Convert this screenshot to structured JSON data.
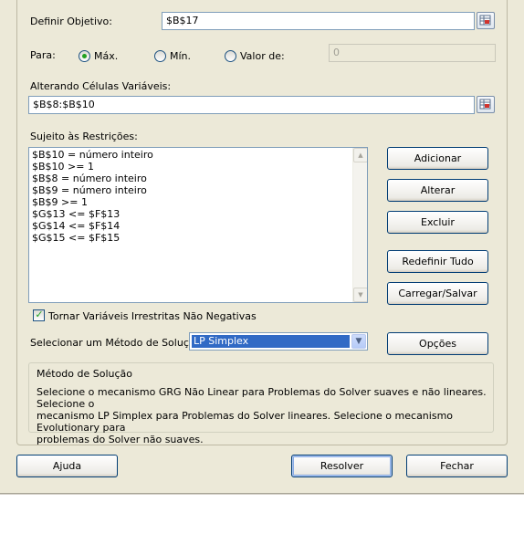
{
  "objective": {
    "label": "Definir Objetivo:",
    "value": "$B$17"
  },
  "para": {
    "label": "Para:",
    "options": [
      {
        "label": "Máx.",
        "selected": true
      },
      {
        "label": "Mín.",
        "selected": false
      },
      {
        "label": "Valor de:",
        "selected": false
      }
    ],
    "value_of": "0"
  },
  "variable_cells": {
    "label": "Alterando Células Variáveis:",
    "value": "$B$8:$B$10"
  },
  "constraints": {
    "label": "Sujeito às Restrições:",
    "items": [
      "$B$10 = número inteiro",
      "$B$10 >= 1",
      "$B$8 = número inteiro",
      "$B$9 = número inteiro",
      "$B$9 >= 1",
      "$G$13 <= $F$13",
      "$G$14 <= $F$14",
      "$G$15 <= $F$15"
    ]
  },
  "side_buttons": {
    "add": "Adicionar",
    "change": "Alterar",
    "delete": "Excluir",
    "reset": "Redefinir Tudo",
    "load_save": "Carregar/Salvar"
  },
  "nonneg": {
    "label": "Tornar Variáveis Irrestritas Não Negativas",
    "checked": true
  },
  "method": {
    "label": "Selecionar um Método de Solução:",
    "selected": "LP Simplex",
    "options_button": "Opções"
  },
  "method_info": {
    "title": "Método de Solução",
    "text_lines": [
      "Selecione o mecanismo GRG Não Linear para Problemas do Solver suaves e não lineares. Selecione o",
      "mecanismo LP Simplex para Problemas do Solver lineares. Selecione o mecanismo Evolutionary para",
      "problemas do Solver não suaves."
    ]
  },
  "footer": {
    "help": "Ajuda",
    "solve": "Resolver",
    "close": "Fechar"
  },
  "colors": {
    "selection": "#316ac5",
    "dialog_bg": "#ece9d8",
    "check_green": "#21a121"
  }
}
